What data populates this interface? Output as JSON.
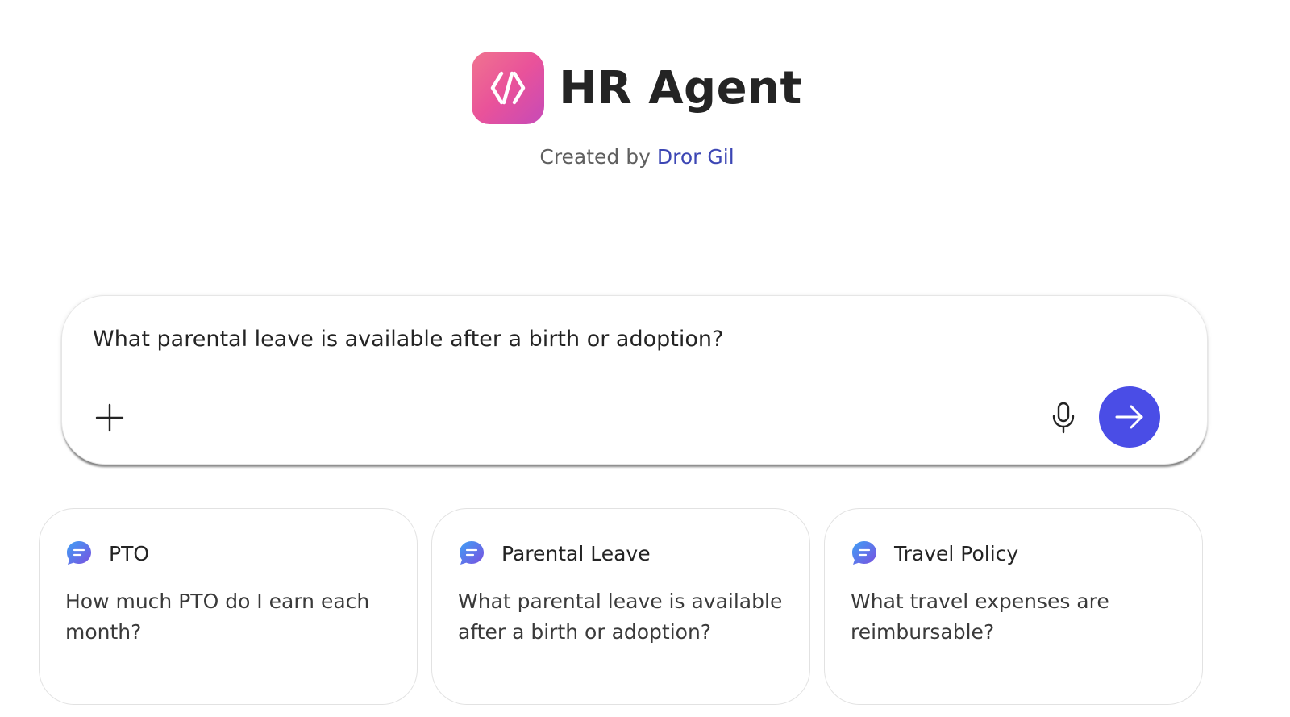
{
  "app": {
    "title": "HR Agent",
    "byline_prefix": "Created by",
    "author": "Dror Gil",
    "logo_icon": "code-brackets-icon"
  },
  "composer": {
    "text": "What parental leave is available after a birth or adoption?",
    "add_icon": "plus-icon",
    "mic_icon": "microphone-icon",
    "send_icon": "arrow-right-icon"
  },
  "suggestions": [
    {
      "title": "PTO",
      "prompt": "How much PTO do I earn each month?",
      "icon": "chat-bubble-icon"
    },
    {
      "title": "Parental Leave",
      "prompt": "What parental leave is available after a birth or adoption?",
      "icon": "chat-bubble-icon"
    },
    {
      "title": "Travel Policy",
      "prompt": "What travel expenses are reimbursable?",
      "icon": "chat-bubble-icon"
    }
  ],
  "colors": {
    "accent": "#4a4de6",
    "author_link": "#3c46b4",
    "logo_gradient_start": "#f0748f",
    "logo_gradient_end": "#c64ab8"
  }
}
